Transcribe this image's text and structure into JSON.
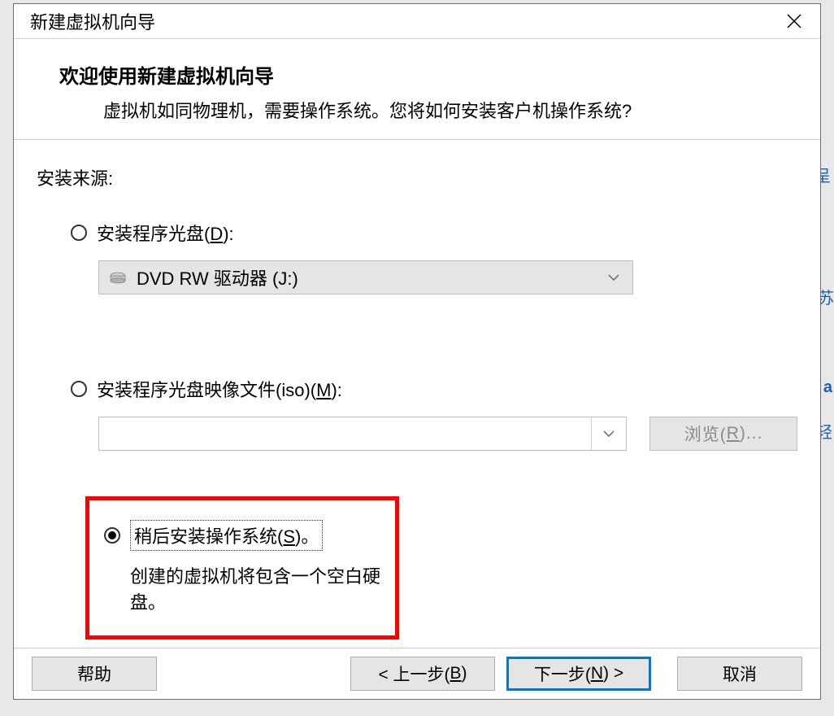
{
  "titlebar": {
    "title": "新建虚拟机向导"
  },
  "header": {
    "heading": "欢迎使用新建虚拟机向导",
    "subtext": "虚拟机如同物理机，需要操作系统。您将如何安装客户机操作系统?"
  },
  "content": {
    "source_label": "安装来源:",
    "option_disc": {
      "label_pre": "安装程序光盘(",
      "label_mnemonic": "D",
      "label_post": "):",
      "dropdown_value": "DVD RW 驱动器 (J:)"
    },
    "option_iso": {
      "label_pre": "安装程序光盘映像文件(iso)(",
      "label_mnemonic": "M",
      "label_post": "):",
      "browse_label_pre": "浏览(",
      "browse_mnemonic": "R",
      "browse_label_post": ")..."
    },
    "option_later": {
      "label_pre": "稍后安装操作系统(",
      "label_mnemonic": "S",
      "label_post": ")。",
      "hint": "创建的虚拟机将包含一个空白硬盘。"
    }
  },
  "buttons": {
    "help": "帮助",
    "back_pre": "< 上一步(",
    "back_mnemonic": "B",
    "back_post": ")",
    "next_pre": "下一步(",
    "next_mnemonic": "N",
    "next_post": ") >",
    "cancel": "取消"
  }
}
